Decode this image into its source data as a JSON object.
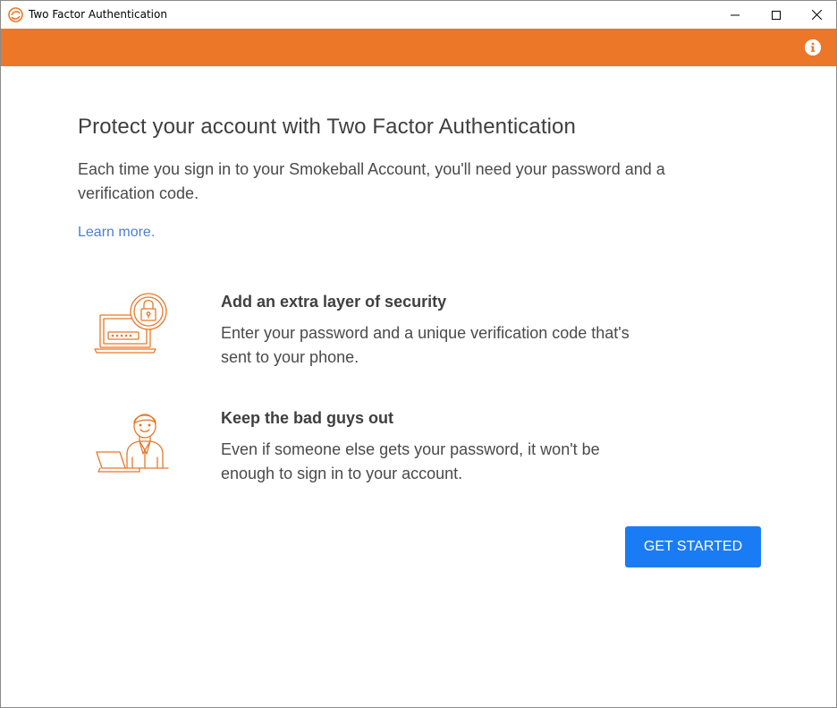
{
  "window": {
    "title": "Two Factor Authentication",
    "app_icon": "smokeball-logo-icon",
    "controls": [
      "minimize-icon",
      "maximize-icon",
      "close-icon"
    ]
  },
  "header": {
    "info_icon": "info-icon",
    "accent_color": "#ec7728"
  },
  "main": {
    "heading": "Protect your account with Two Factor Authentication",
    "subtext": "Each time you sign in to your Smokeball Account, you'll need your password and a verification code.",
    "learn_more": "Learn more.",
    "features": [
      {
        "icon": "laptop-lock-icon",
        "title": "Add an extra layer of security",
        "description": "Enter your password and a unique verification code that's sent to your phone."
      },
      {
        "icon": "person-laptop-icon",
        "title": "Keep the bad guys out",
        "description": "Even if someone else gets your password, it won't be enough to sign in to your account."
      }
    ],
    "button_label": "GET STARTED",
    "button_color": "#1a7cf5",
    "link_color": "#4a7fd6"
  }
}
